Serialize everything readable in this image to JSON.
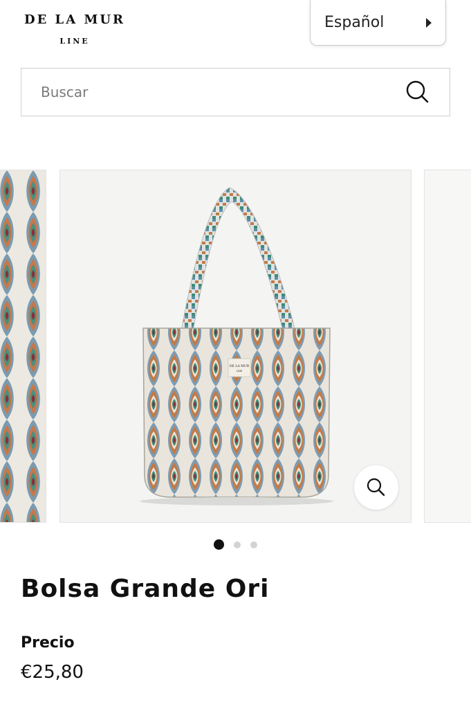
{
  "header": {
    "logo_line1": "DE LA MUR",
    "logo_line2": "LINE"
  },
  "language_popup": {
    "label": "Español"
  },
  "search": {
    "placeholder": "Buscar"
  },
  "gallery": {
    "label_line1": "DE LA MUR",
    "label_line2": "LINE",
    "slide_count": 3,
    "active_index": 0
  },
  "product": {
    "title": "Bolsa Grande Ori",
    "price_label": "Precio",
    "price": "€25,80"
  },
  "colors": {
    "accent": "#111111",
    "dot_inactive": "#d3d3d3",
    "border": "#cfcfcf"
  }
}
